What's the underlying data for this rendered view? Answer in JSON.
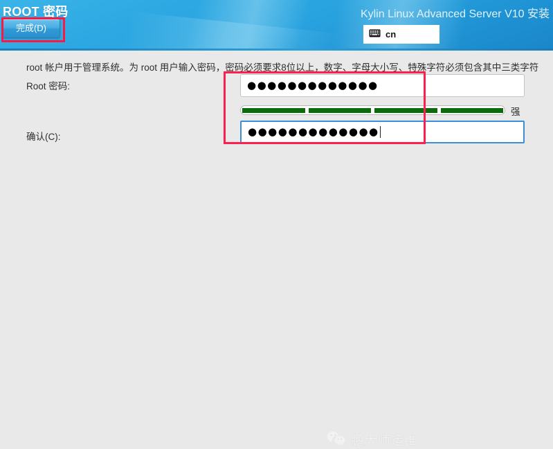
{
  "header": {
    "page_title": "ROOT 密码",
    "product_title": "Kylin Linux Advanced Server V10 安装",
    "done_button_label": "完成(D)",
    "keyboard_indicator": {
      "icon": "keyboard-icon",
      "glyph": "⌨",
      "label": "cn"
    },
    "accent_color": "#29a3df",
    "annotation_color": "#ff1744"
  },
  "main": {
    "hint_text": "root 帐户用于管理系统。为 root 用户输入密码，密码必须要求8位以上，数字、字母大小写、特殊字符必须包含其中三类字符",
    "root_password": {
      "label": "Root 密码:",
      "value": "●●●●●●●●●●●●●",
      "placeholder": ""
    },
    "confirm_password": {
      "label": "确认(C):",
      "value": "●●●●●●●●●●●●●",
      "placeholder": ""
    },
    "strength": {
      "label": "强",
      "segments": 4,
      "filled": 4,
      "color": "#0a6b0a"
    },
    "annotation_color": "#ff1f4e"
  },
  "watermark": {
    "icon": "wechat-icon",
    "text": "鹏大师运维"
  }
}
